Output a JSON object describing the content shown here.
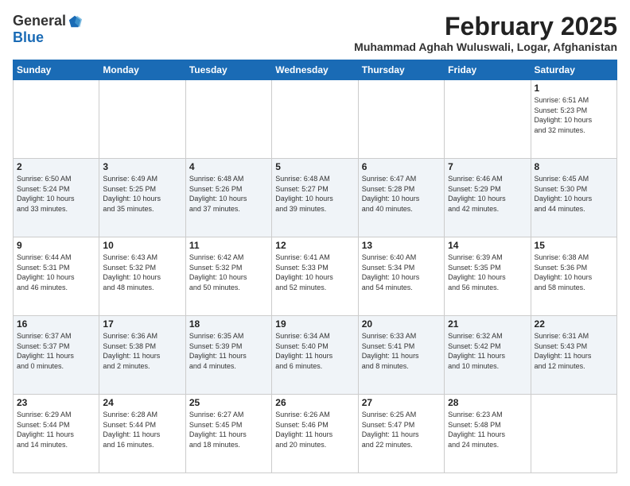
{
  "header": {
    "logo_general": "General",
    "logo_blue": "Blue",
    "month_title": "February 2025",
    "location": "Muhammad Aghah Wuluswali, Logar, Afghanistan"
  },
  "weekdays": [
    "Sunday",
    "Monday",
    "Tuesday",
    "Wednesday",
    "Thursday",
    "Friday",
    "Saturday"
  ],
  "weeks": [
    [
      {
        "day": "",
        "info": ""
      },
      {
        "day": "",
        "info": ""
      },
      {
        "day": "",
        "info": ""
      },
      {
        "day": "",
        "info": ""
      },
      {
        "day": "",
        "info": ""
      },
      {
        "day": "",
        "info": ""
      },
      {
        "day": "1",
        "info": "Sunrise: 6:51 AM\nSunset: 5:23 PM\nDaylight: 10 hours\nand 32 minutes."
      }
    ],
    [
      {
        "day": "2",
        "info": "Sunrise: 6:50 AM\nSunset: 5:24 PM\nDaylight: 10 hours\nand 33 minutes."
      },
      {
        "day": "3",
        "info": "Sunrise: 6:49 AM\nSunset: 5:25 PM\nDaylight: 10 hours\nand 35 minutes."
      },
      {
        "day": "4",
        "info": "Sunrise: 6:48 AM\nSunset: 5:26 PM\nDaylight: 10 hours\nand 37 minutes."
      },
      {
        "day": "5",
        "info": "Sunrise: 6:48 AM\nSunset: 5:27 PM\nDaylight: 10 hours\nand 39 minutes."
      },
      {
        "day": "6",
        "info": "Sunrise: 6:47 AM\nSunset: 5:28 PM\nDaylight: 10 hours\nand 40 minutes."
      },
      {
        "day": "7",
        "info": "Sunrise: 6:46 AM\nSunset: 5:29 PM\nDaylight: 10 hours\nand 42 minutes."
      },
      {
        "day": "8",
        "info": "Sunrise: 6:45 AM\nSunset: 5:30 PM\nDaylight: 10 hours\nand 44 minutes."
      }
    ],
    [
      {
        "day": "9",
        "info": "Sunrise: 6:44 AM\nSunset: 5:31 PM\nDaylight: 10 hours\nand 46 minutes."
      },
      {
        "day": "10",
        "info": "Sunrise: 6:43 AM\nSunset: 5:32 PM\nDaylight: 10 hours\nand 48 minutes."
      },
      {
        "day": "11",
        "info": "Sunrise: 6:42 AM\nSunset: 5:32 PM\nDaylight: 10 hours\nand 50 minutes."
      },
      {
        "day": "12",
        "info": "Sunrise: 6:41 AM\nSunset: 5:33 PM\nDaylight: 10 hours\nand 52 minutes."
      },
      {
        "day": "13",
        "info": "Sunrise: 6:40 AM\nSunset: 5:34 PM\nDaylight: 10 hours\nand 54 minutes."
      },
      {
        "day": "14",
        "info": "Sunrise: 6:39 AM\nSunset: 5:35 PM\nDaylight: 10 hours\nand 56 minutes."
      },
      {
        "day": "15",
        "info": "Sunrise: 6:38 AM\nSunset: 5:36 PM\nDaylight: 10 hours\nand 58 minutes."
      }
    ],
    [
      {
        "day": "16",
        "info": "Sunrise: 6:37 AM\nSunset: 5:37 PM\nDaylight: 11 hours\nand 0 minutes."
      },
      {
        "day": "17",
        "info": "Sunrise: 6:36 AM\nSunset: 5:38 PM\nDaylight: 11 hours\nand 2 minutes."
      },
      {
        "day": "18",
        "info": "Sunrise: 6:35 AM\nSunset: 5:39 PM\nDaylight: 11 hours\nand 4 minutes."
      },
      {
        "day": "19",
        "info": "Sunrise: 6:34 AM\nSunset: 5:40 PM\nDaylight: 11 hours\nand 6 minutes."
      },
      {
        "day": "20",
        "info": "Sunrise: 6:33 AM\nSunset: 5:41 PM\nDaylight: 11 hours\nand 8 minutes."
      },
      {
        "day": "21",
        "info": "Sunrise: 6:32 AM\nSunset: 5:42 PM\nDaylight: 11 hours\nand 10 minutes."
      },
      {
        "day": "22",
        "info": "Sunrise: 6:31 AM\nSunset: 5:43 PM\nDaylight: 11 hours\nand 12 minutes."
      }
    ],
    [
      {
        "day": "23",
        "info": "Sunrise: 6:29 AM\nSunset: 5:44 PM\nDaylight: 11 hours\nand 14 minutes."
      },
      {
        "day": "24",
        "info": "Sunrise: 6:28 AM\nSunset: 5:44 PM\nDaylight: 11 hours\nand 16 minutes."
      },
      {
        "day": "25",
        "info": "Sunrise: 6:27 AM\nSunset: 5:45 PM\nDaylight: 11 hours\nand 18 minutes."
      },
      {
        "day": "26",
        "info": "Sunrise: 6:26 AM\nSunset: 5:46 PM\nDaylight: 11 hours\nand 20 minutes."
      },
      {
        "day": "27",
        "info": "Sunrise: 6:25 AM\nSunset: 5:47 PM\nDaylight: 11 hours\nand 22 minutes."
      },
      {
        "day": "28",
        "info": "Sunrise: 6:23 AM\nSunset: 5:48 PM\nDaylight: 11 hours\nand 24 minutes."
      },
      {
        "day": "",
        "info": ""
      }
    ]
  ]
}
